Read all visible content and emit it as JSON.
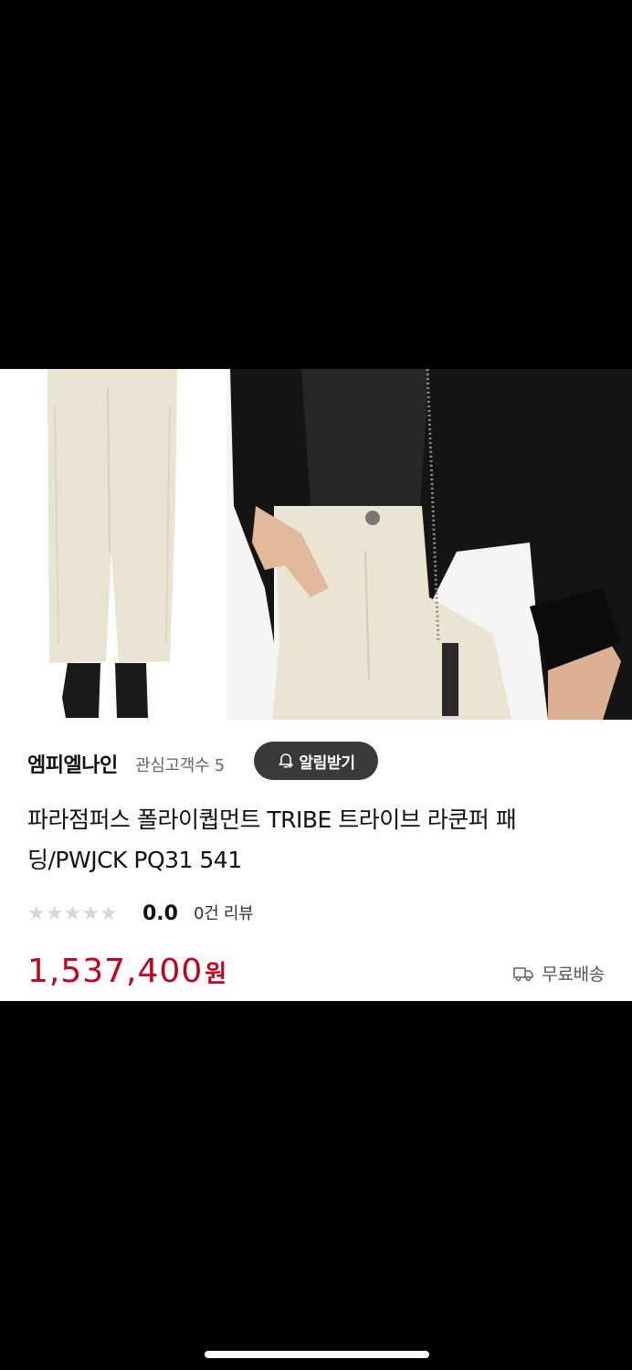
{
  "product": {
    "brand": "엠피엘나인",
    "interest_label": "관심고객수 5",
    "alarm_label": "알림받기",
    "title": "파라점퍼스 폴라이퀍먼트 TRIBE 트라이브 라쿤퍼 패딩/PWJCK PQ31 541",
    "rating_score": "0.0",
    "review_count": "0건 리뷰",
    "price": "1,537,400",
    "currency": "원",
    "shipping": "무료배송"
  },
  "colors": {
    "price": "#c4001e",
    "alarm_button_bg": "#3a3a3a",
    "star_empty": "#d7d7d7"
  },
  "icons": {
    "alarm": "bell-plus-icon",
    "shipping": "truck-icon",
    "star": "star-icon"
  }
}
